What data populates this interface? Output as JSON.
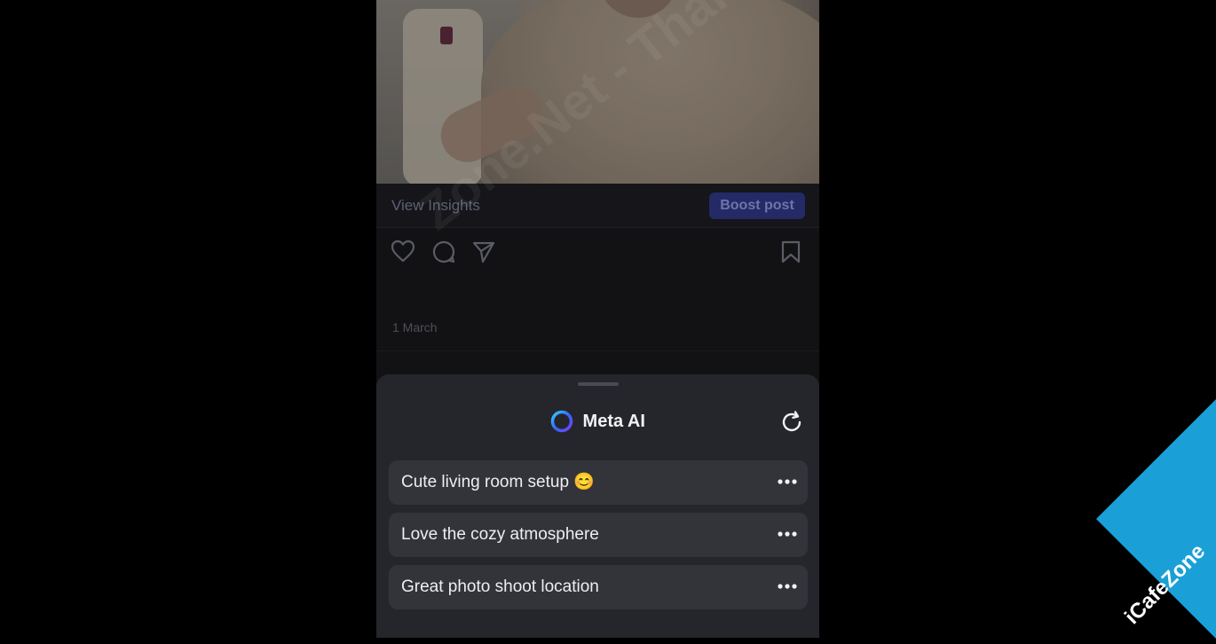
{
  "post": {
    "view_insights": "View Insights",
    "boost_post": "Boost post",
    "date": "1 March"
  },
  "sheet": {
    "title": "Meta AI",
    "suggestions": [
      {
        "text": "Cute living room setup 😊"
      },
      {
        "text": "Love the cozy atmosphere"
      },
      {
        "text": "Great photo shoot location"
      }
    ]
  },
  "watermark": {
    "text": "Zone.Net - Thái Kenpo.com",
    "badge": "iCafeZone"
  },
  "colors": {
    "boost_bg": "#232a66",
    "sheet_bg": "#25262b",
    "suggestion_bg": "#33343a"
  },
  "icons": [
    "heart-icon",
    "comment-icon",
    "share-icon",
    "bookmark-icon",
    "meta-ai-icon",
    "refresh-icon",
    "more-icon"
  ]
}
